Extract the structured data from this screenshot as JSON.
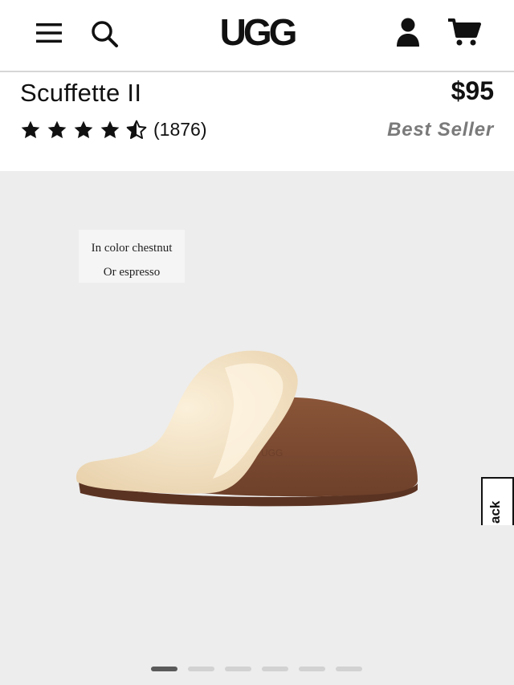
{
  "header": {
    "logo_text": "UGG",
    "icons": {
      "menu": "hamburger-menu-icon",
      "search": "search-icon",
      "account": "account-icon",
      "cart": "cart-icon"
    }
  },
  "product": {
    "title": "Scuffette II",
    "price": "$95",
    "rating": 4.5,
    "rating_max": 5,
    "review_count": "(1876)",
    "badge": "Best Seller"
  },
  "gallery": {
    "caption_line1": "In color chestnut",
    "caption_line2": "Or espresso",
    "image_count": 6,
    "active_index": 1
  },
  "feedback_tab": {
    "label": "ack"
  },
  "colors": {
    "gallery_bg": "#ededed",
    "badge_text": "#7a7a7a",
    "dot_active": "#5a5a5a",
    "dot_inactive": "#d2d2d2",
    "slipper_suede": "#7b4a32",
    "slipper_fur": "#f3e2c4"
  }
}
